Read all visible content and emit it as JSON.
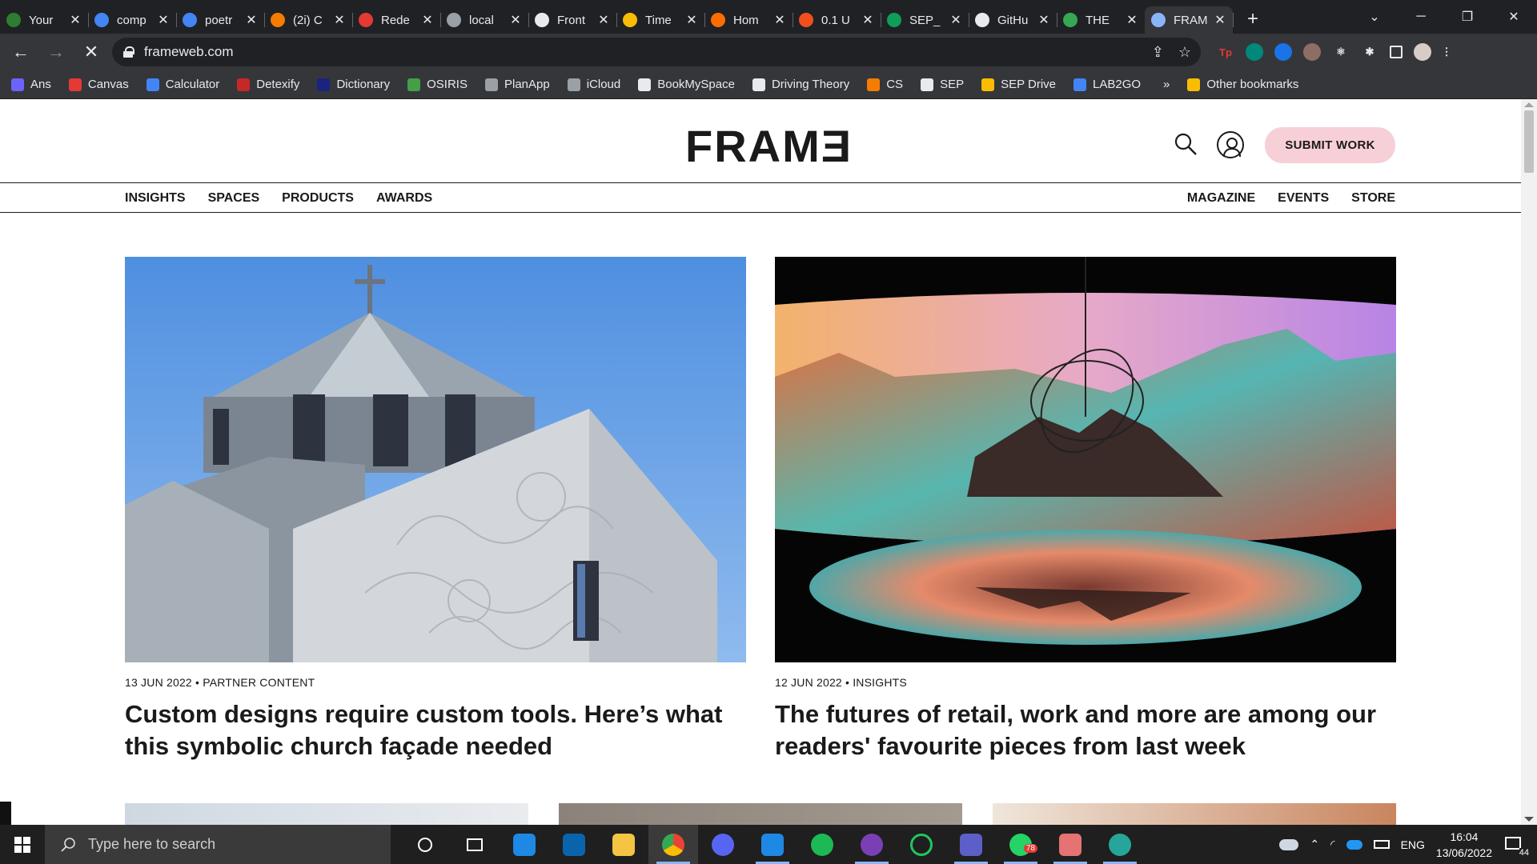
{
  "browser": {
    "tabs": [
      {
        "label": "Your",
        "color": "#2e7d32"
      },
      {
        "label": "comp",
        "color": "#4285f4"
      },
      {
        "label": "poetr",
        "color": "#4285f4"
      },
      {
        "label": "(2i) C",
        "color": "#f57c00"
      },
      {
        "label": "Rede",
        "color": "#e53935"
      },
      {
        "label": "local",
        "color": "#9aa0a6"
      },
      {
        "label": "Front",
        "color": "#e8eaed"
      },
      {
        "label": "Time",
        "color": "#fbbc04"
      },
      {
        "label": "Hom",
        "color": "#ff6d00"
      },
      {
        "label": "0.1 U",
        "color": "#f24e1e"
      },
      {
        "label": "SEP_",
        "color": "#0f9d58"
      },
      {
        "label": "GitHu",
        "color": "#e8eaed"
      },
      {
        "label": "THE",
        "color": "#34a853"
      },
      {
        "label": "FRAM",
        "color": "#8ab4f8"
      }
    ],
    "active_tab_index": 13,
    "url": "frameweb.com",
    "bookmarks": [
      {
        "label": "Ans",
        "color": "#6c63ff"
      },
      {
        "label": "Canvas",
        "color": "#e53935"
      },
      {
        "label": "Calculator",
        "color": "#4285f4"
      },
      {
        "label": "Detexify",
        "color": "#c62828"
      },
      {
        "label": "Dictionary",
        "color": "#1a237e"
      },
      {
        "label": "OSIRIS",
        "color": "#43a047"
      },
      {
        "label": "PlanApp",
        "color": "#9aa0a6"
      },
      {
        "label": "iCloud",
        "color": "#9aa0a6"
      },
      {
        "label": "BookMySpace",
        "color": "#e8eaed"
      },
      {
        "label": "Driving Theory",
        "color": "#e8eaed"
      },
      {
        "label": "CS",
        "color": "#f57c00"
      },
      {
        "label": "SEP",
        "color": "#e8eaed"
      },
      {
        "label": "SEP Drive",
        "color": "#fbbc04"
      },
      {
        "label": "LAB2GO",
        "color": "#4285f4"
      }
    ],
    "other_bookmarks": "Other bookmarks",
    "overflow": "»"
  },
  "site": {
    "logo": "FRAMƎ",
    "submit_label": "SUBMIT WORK",
    "nav_left": [
      "INSIGHTS",
      "SPACES",
      "PRODUCTS",
      "AWARDS"
    ],
    "nav_right": [
      "MAGAZINE",
      "EVENTS",
      "STORE"
    ],
    "articles": [
      {
        "meta": "13 JUN 2022 • PARTNER CONTENT",
        "title": "Custom designs require custom tools. Here’s what this symbolic church façade needed"
      },
      {
        "meta": "12 JUN 2022 • INSIGHTS",
        "title": "The futures of retail, work and more are among our readers' favourite pieces from last week"
      }
    ]
  },
  "taskbar": {
    "search_placeholder": "Type here to search",
    "lang": "ENG",
    "time": "16:04",
    "date": "13/06/2022",
    "notification_count": "44",
    "whatsapp_badge": "78"
  }
}
